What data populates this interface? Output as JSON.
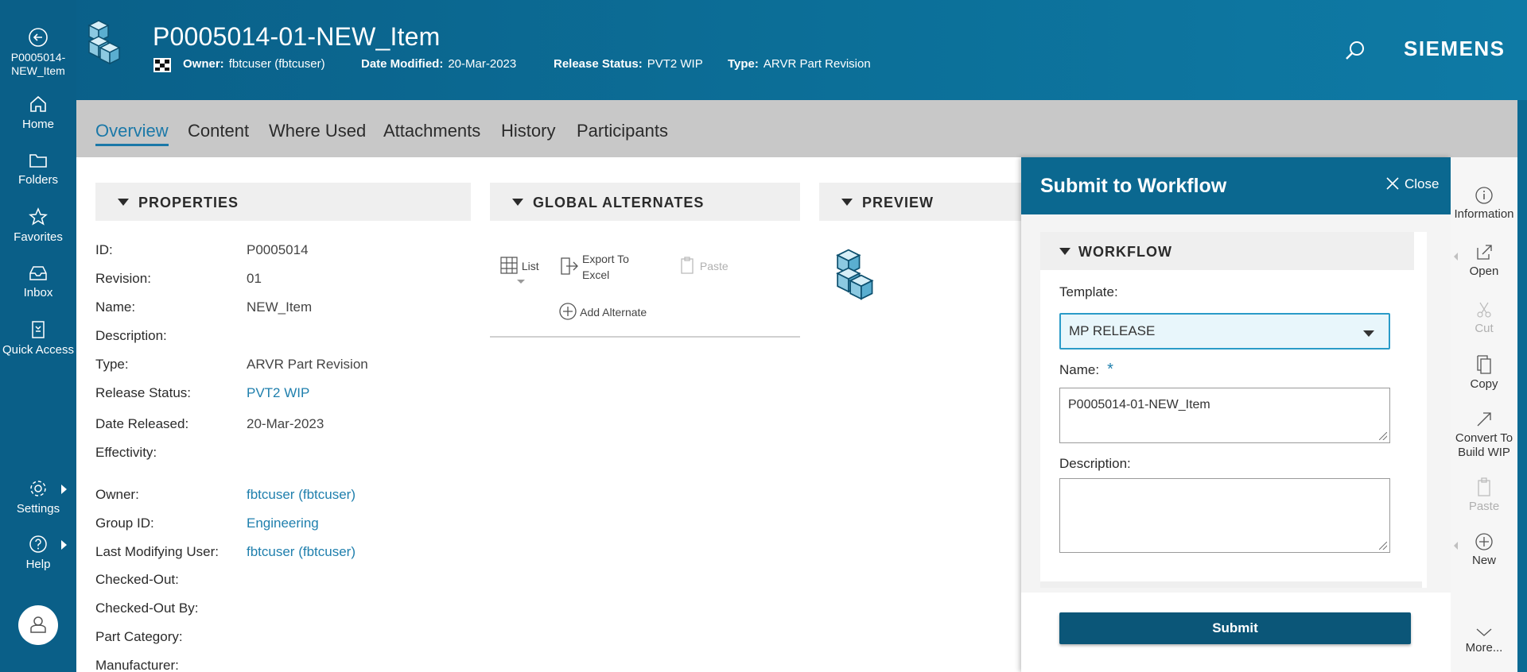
{
  "leftrail": {
    "back": "P0005014-NEW_Item",
    "items": [
      {
        "label": "Home",
        "icon": "home-icon"
      },
      {
        "label": "Folders",
        "icon": "folder-icon"
      },
      {
        "label": "Favorites",
        "icon": "star-icon"
      },
      {
        "label": "Inbox",
        "icon": "inbox-icon"
      },
      {
        "label": "Quick Access",
        "icon": "quick-access-icon"
      },
      {
        "label": "Settings",
        "icon": "gear-icon"
      },
      {
        "label": "Help",
        "icon": "help-icon"
      }
    ]
  },
  "header": {
    "title": "P0005014-01-NEW_Item",
    "owner_label": "Owner:",
    "owner_value": "fbtcuser (fbtcuser)",
    "modified_label": "Date Modified:",
    "modified_value": "20-Mar-2023",
    "release_label": "Release Status:",
    "release_value": "PVT2 WIP",
    "type_label": "Type:",
    "type_value": "ARVR Part Revision",
    "brand": "SIEMENS"
  },
  "tabs": [
    "Overview",
    "Content",
    "Where Used",
    "Attachments",
    "History",
    "Participants"
  ],
  "properties": {
    "title": "PROPERTIES",
    "rows": [
      {
        "label": "ID:",
        "value": "P0005014"
      },
      {
        "label": "Revision:",
        "value": "01"
      },
      {
        "label": "Name:",
        "value": "NEW_Item"
      },
      {
        "label": "Description:",
        "value": ""
      },
      {
        "label": "Type:",
        "value": "ARVR Part Revision"
      },
      {
        "label": "Release Status:",
        "value": "PVT2 WIP"
      },
      {
        "label": "Date Released:",
        "value": "20-Mar-2023"
      },
      {
        "label": "Effectivity:",
        "value": ""
      },
      {
        "label": "Owner:",
        "value": "fbtcuser (fbtcuser)"
      },
      {
        "label": "Group ID:",
        "value": "Engineering"
      },
      {
        "label": "Last Modifying User:",
        "value": "fbtcuser (fbtcuser)"
      },
      {
        "label": "Checked-Out:",
        "value": ""
      },
      {
        "label": "Checked-Out By:",
        "value": ""
      },
      {
        "label": "Part Category:",
        "value": ""
      },
      {
        "label": "Manufacturer:",
        "value": ""
      }
    ]
  },
  "global_alternates": {
    "title": "GLOBAL ALTERNATES",
    "list": "List",
    "export": "Export To Excel",
    "paste": "Paste",
    "add": "Add Alternate"
  },
  "preview": {
    "title": "PREVIEW"
  },
  "workflow_panel": {
    "title": "Submit to Workflow",
    "close": "Close",
    "section": "WORKFLOW",
    "template_label": "Template:",
    "template_value": "MP RELEASE",
    "name_label": "Name:",
    "required_mark": "*",
    "name_value": "P0005014-01-NEW_Item",
    "description_label": "Description:",
    "description_value": "",
    "submit": "Submit"
  },
  "rightrail": {
    "items": [
      {
        "label": "Information",
        "icon": "info-icon",
        "enabled": true
      },
      {
        "label": "Open",
        "icon": "open-icon",
        "enabled": true
      },
      {
        "label": "Cut",
        "icon": "cut-icon",
        "enabled": false
      },
      {
        "label": "Copy",
        "icon": "copy-icon",
        "enabled": true
      },
      {
        "label": "Convert To Build WIP",
        "icon": "convert-icon",
        "enabled": true
      },
      {
        "label": "Paste",
        "icon": "paste-icon",
        "enabled": false
      },
      {
        "label": "New",
        "icon": "new-icon",
        "enabled": true
      },
      {
        "label": "More...",
        "icon": "more-icon",
        "enabled": true
      }
    ]
  },
  "colors": {
    "brand": "#0b6a93",
    "accent": "#1f7fad",
    "submit": "#0b5678"
  }
}
